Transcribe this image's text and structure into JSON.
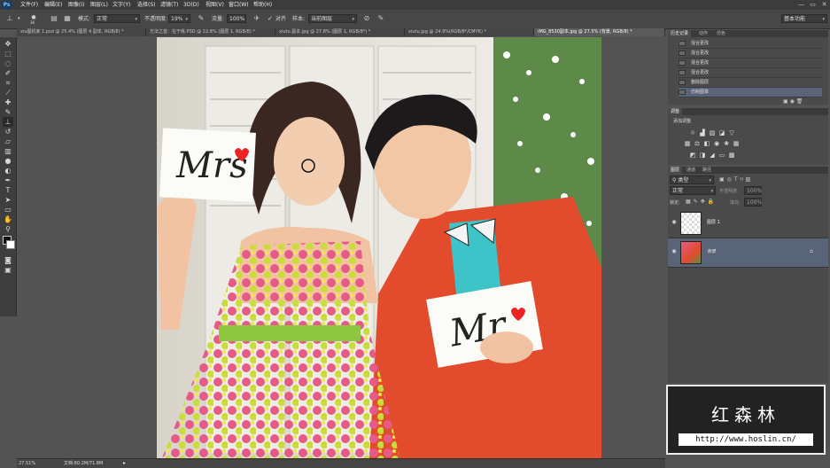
{
  "app": {
    "logo": "Ps"
  },
  "menu": [
    "文件(F)",
    "编辑(E)",
    "图像(I)",
    "图层(L)",
    "文字(Y)",
    "选择(S)",
    "滤镜(T)",
    "3D(D)",
    "视图(V)",
    "窗口(W)",
    "帮助(H)"
  ],
  "window_controls": [
    "—",
    "▭",
    "✕"
  ],
  "options": {
    "brush_size": "36",
    "mode_label": "模式:",
    "mode_value": "正常",
    "opacity_label": "不透明度:",
    "opacity_value": "19%",
    "flow_label": "流量:",
    "flow_value": "100%",
    "aligned_label": "对齐",
    "sample_label": "样本:",
    "sample_value": "当前图层",
    "workspace": "基本功能"
  },
  "tabs": [
    {
      "label": "xiu图机家 1.psd @ 25.4% (图层 4 副本, RGB/8) *",
      "active": false
    },
    {
      "label": "方法之首：在于练.PSD @ 22.8% (图层 1, RGB/8) *",
      "active": false
    },
    {
      "label": "xiutu 副本.jpg @ 27.8% (图层 1, RGB/8*) *",
      "active": false
    },
    {
      "label": "xiutu.jpg @ 24.9%(RGB/8*/CMYK) *",
      "active": false
    },
    {
      "label": "IMG_8530副本.jpg @ 27.5% (背景, RGB/8) *",
      "active": true
    }
  ],
  "photo_signs": {
    "left": "Mrs",
    "right": "Mr"
  },
  "status": {
    "zoom": "27.51%",
    "doc": "文档:60.2M/71.8M"
  },
  "history_panel": {
    "tabs": [
      "历史记录",
      "动作",
      "仿色"
    ],
    "items": [
      "混合更改",
      "混合更改",
      "混合更改",
      "混合更改",
      "删除图层",
      "仿制图章"
    ]
  },
  "adjust_panel": {
    "tabs": [
      "调整"
    ],
    "title": "添加调整"
  },
  "layers_panel": {
    "tabs": [
      "图层",
      "通道",
      "路径"
    ],
    "kind_value": "类型",
    "blend_value": "正常",
    "opacity_label": "不透明度:",
    "opacity_value": "100%",
    "lock_label": "锁定:",
    "fill_label": "填充:",
    "fill_value": "100%",
    "layers": [
      {
        "name": "图层 1",
        "selected": false
      },
      {
        "name": "背景",
        "selected": true
      }
    ]
  },
  "watermark": {
    "title": "红森林",
    "url": "http://www.hoslin.cn/"
  }
}
